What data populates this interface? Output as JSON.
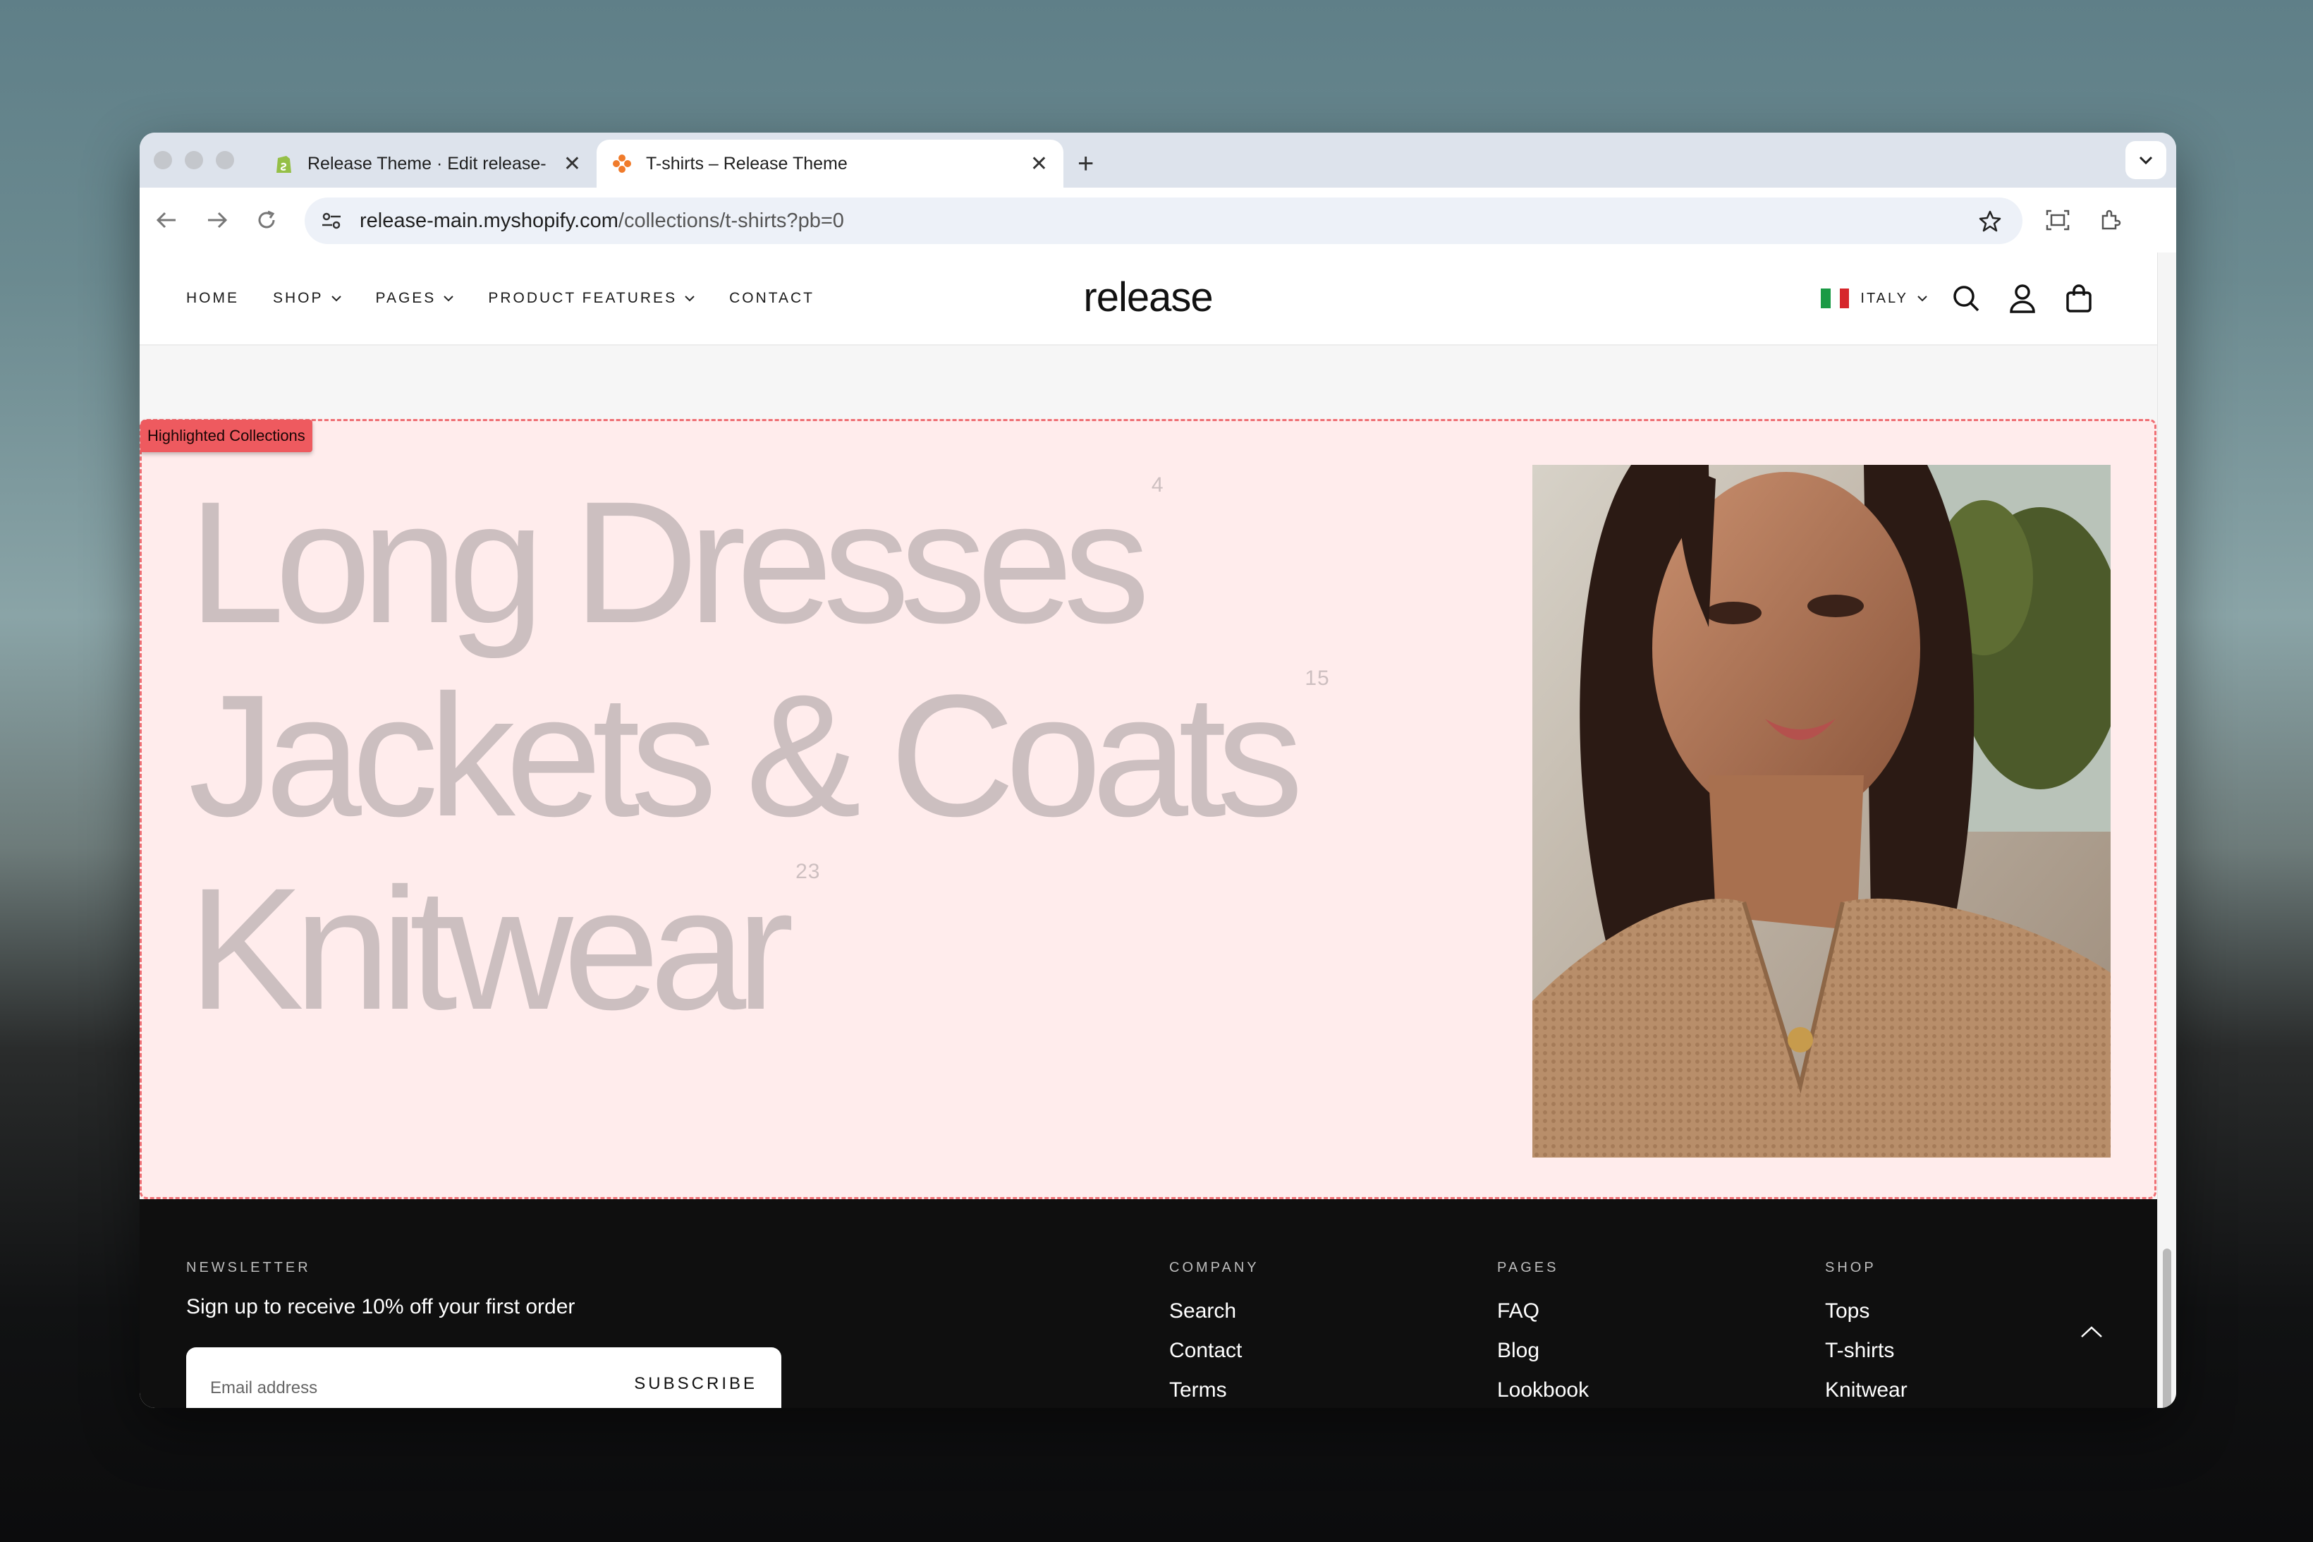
{
  "browser": {
    "tabs": [
      {
        "title": "Release Theme · Edit release-",
        "favicon": "shopify-icon",
        "active": false
      },
      {
        "title": "T-shirts – Release Theme",
        "favicon": "release-theme-icon",
        "active": true
      }
    ],
    "address": {
      "domain": "release-main.myshopify.com",
      "path": "/collections/t-shirts?pb=0"
    }
  },
  "site": {
    "nav": [
      {
        "label": "HOME",
        "dropdown": false
      },
      {
        "label": "SHOP",
        "dropdown": true
      },
      {
        "label": "PAGES",
        "dropdown": true
      },
      {
        "label": "PRODUCT FEATURES",
        "dropdown": true
      },
      {
        "label": "CONTACT",
        "dropdown": false
      }
    ],
    "logo": "release",
    "country": "ITALY",
    "flag_colors": [
      "#1a9a45",
      "#ffffff",
      "#d6262b"
    ]
  },
  "highlight": {
    "tag": "Highlighted Collections",
    "collections": [
      {
        "name": "Long Dresses",
        "count": "4"
      },
      {
        "name": "Jackets & Coats",
        "count": "15"
      },
      {
        "name": "Knitwear",
        "count": "23"
      }
    ]
  },
  "footer": {
    "newsletter": {
      "label": "NEWSLETTER",
      "text": "Sign up to receive 10% off your first order",
      "placeholder": "Email address",
      "button": "SUBSCRIBE"
    },
    "columns": [
      {
        "label": "COMPANY",
        "links": [
          "Search",
          "Contact",
          "Terms"
        ]
      },
      {
        "label": "PAGES",
        "links": [
          "FAQ",
          "Blog",
          "Lookbook"
        ]
      },
      {
        "label": "SHOP",
        "links": [
          "Tops",
          "T-shirts",
          "Knitwear"
        ]
      }
    ]
  },
  "colors": {
    "highlight_bg": "#ffecec",
    "highlight_border": "#ef6f74",
    "collection_text": "#ccbfc0",
    "footer_bg": "#0f0f0f"
  }
}
